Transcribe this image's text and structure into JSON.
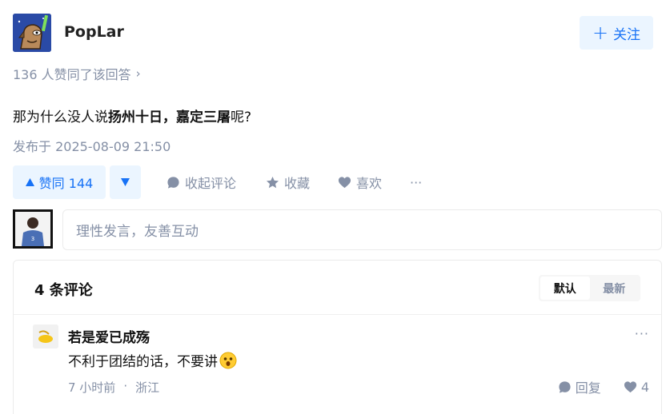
{
  "author": {
    "name": "PopLar",
    "follow_label": "关注"
  },
  "voters_text": "136 人赞同了该回答",
  "answer": {
    "text_pre": "那为什么没人说",
    "text_bold": "扬州十日，嘉定三屠",
    "text_post": "呢?",
    "published": "发布于 2025-08-09 21:50"
  },
  "actions": {
    "upvote_label": "赞同 144",
    "collapse_comments": "收起评论",
    "favorite": "收藏",
    "like": "喜欢",
    "more": "···"
  },
  "comment_input": {
    "placeholder": "理性发言，友善互动"
  },
  "comments": {
    "count_label": "4 条评论",
    "sort": [
      "默认",
      "最新"
    ],
    "items": [
      {
        "name": "若是爱已成殇",
        "text": "不利于团结的话，不要讲",
        "time": "7 小时前",
        "location": "浙江",
        "reply_label": "回复",
        "likes": "4"
      }
    ]
  },
  "colors": {
    "accent": "#1772f6",
    "accent_bg": "#ebf5ff",
    "muted": "#8590a6"
  }
}
